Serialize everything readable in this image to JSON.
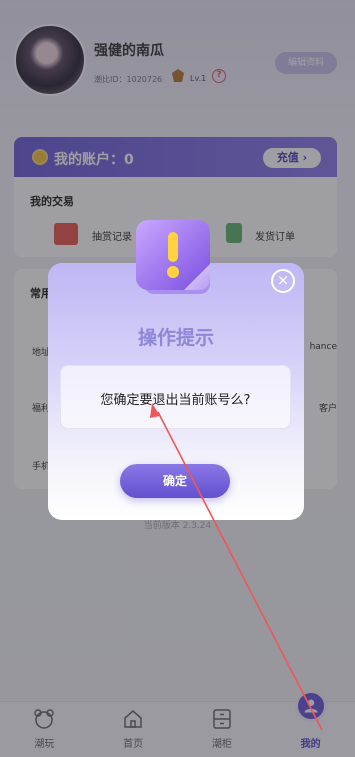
{
  "profile": {
    "nickname": "强健的南瓜",
    "uid": "潮比ID：1020726",
    "level": "Lv.1",
    "help": "?",
    "edit_label": "编辑资料"
  },
  "account": {
    "label": "我的账户：0",
    "recharge_label": "充值"
  },
  "trade": {
    "title": "我的交易",
    "items": [
      {
        "label": "抽赏记录"
      },
      {
        "label": "发货订单"
      }
    ]
  },
  "common": {
    "title": "常用",
    "rows_left": [
      "地址",
      "福利",
      "手机"
    ],
    "rows_right": [
      "hance",
      "客户"
    ]
  },
  "version": "当前版本 2.3.24",
  "tabbar": {
    "items": [
      {
        "label": "潮玩",
        "icon": "bear-icon"
      },
      {
        "label": "首页",
        "icon": "home-icon"
      },
      {
        "label": "潮柜",
        "icon": "cabinet-icon"
      },
      {
        "label": "我的",
        "icon": "user-icon",
        "active": true
      }
    ]
  },
  "dialog": {
    "title": "操作提示",
    "close": "×",
    "message": "您确定要退出当前账号么?",
    "confirm_label": "确定"
  },
  "colors": {
    "accent": "#6a57d8",
    "annotation_arrow": "#f05656"
  }
}
